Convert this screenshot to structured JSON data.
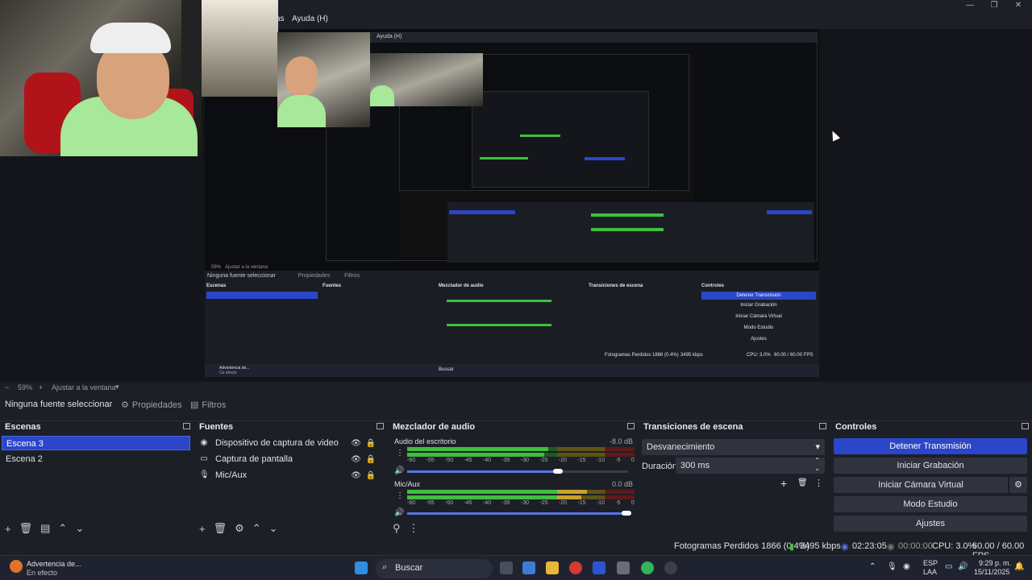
{
  "menu": {
    "frag": "as",
    "help": "Ayuda (H)"
  },
  "nested": {
    "help": "Ayuda (H)",
    "no_source": "Ninguna fuente seleccionar",
    "props": "Propiedades",
    "filters": "Filtros",
    "scenes": "Escenas",
    "sources": "Fuentes",
    "mixer": "Mezclador de audio",
    "transitions": "Transiciones de escena",
    "controls": "Controles",
    "stop": "Detener Transmisión",
    "rec": "Iniciar Grabación",
    "vcam": "Iniciar Cámara Virtual",
    "studio": "Modo Estudio",
    "settings": "Ajustes",
    "status": "Fotogramas Perdidos 1866 (0.4%)",
    "kbps": "3495 kbps",
    "cpu": "CPU: 3.0%",
    "fps": "60.00 / 60.00 FPS",
    "zoom": "59%",
    "fit": "Ajustar a la ventana",
    "warn": "Advertencia de...",
    "warn2": "Ce efecto",
    "search": "Buscar"
  },
  "zoom": {
    "value": "59%",
    "fit_label": "Ajustar a la ventana"
  },
  "source_toolbar": {
    "no_source": "Ninguna fuente seleccionar",
    "properties": "Propiedades",
    "filters": "Filtros"
  },
  "scenes": {
    "title": "Escenas",
    "items": [
      "Escena 3",
      "Escena 2"
    ],
    "active_index": 0
  },
  "sources": {
    "title": "Fuentes",
    "items": [
      {
        "icon": "camera-icon",
        "label": "Dispositivo de captura de video"
      },
      {
        "icon": "monitor-icon",
        "label": "Captura de pantalla"
      },
      {
        "icon": "microphone-icon",
        "label": "Mic/Aux"
      }
    ]
  },
  "mixer": {
    "title": "Mezclador de audio",
    "channels": [
      {
        "name": "Audio del escritorio",
        "db": "-8.0 dB",
        "level": 0.62,
        "volume": 0.69
      },
      {
        "name": "Mic/Aux",
        "db": "0.0 dB",
        "level": 0.79,
        "volume": 1.0
      }
    ],
    "ticks": [
      "-60",
      "-55",
      "-50",
      "-45",
      "-40",
      "-35",
      "-30",
      "-25",
      "-20",
      "-15",
      "-10",
      "-5",
      "0"
    ]
  },
  "transitions": {
    "title": "Transiciones de escena",
    "selected": "Desvanecimiento",
    "duration_label": "Duración",
    "duration_value": "300 ms"
  },
  "controls": {
    "title": "Controles",
    "stop_stream": "Detener Transmisión",
    "start_recording": "Iniciar Grabación",
    "start_virtual_cam": "Iniciar Cámara Virtual",
    "studio_mode": "Modo Estudio",
    "settings": "Ajustes"
  },
  "status": {
    "dropped_frames": "Fotogramas Perdidos 1866 (0.4%)",
    "bitrate": "3495 kbps",
    "stream_time": "02:23:05",
    "rec_time": "00:00:00",
    "cpu": "CPU: 3.0%",
    "fps": "60.00 / 60.00 FPS"
  },
  "taskbar": {
    "notif_title": "Advertencia de...",
    "notif_sub": "En efecto",
    "search": "Buscar",
    "lang": "ESP",
    "lang2": "LAA",
    "time": "9:29 p. m.",
    "date": "15/11/2025"
  },
  "colors": {
    "accent": "#2b46c8",
    "meter_green": "#3fbf3f",
    "meter_yellow": "#c9a22b",
    "meter_red": "#c8282e"
  }
}
